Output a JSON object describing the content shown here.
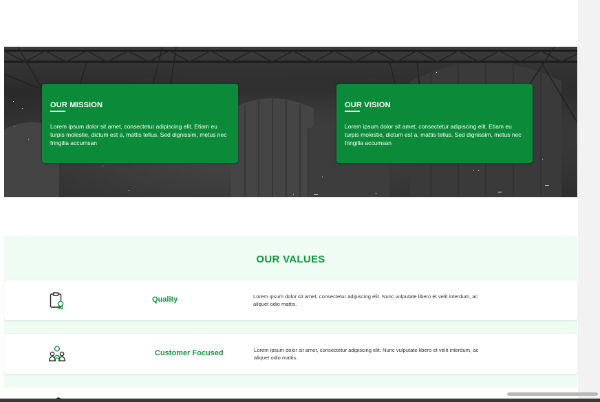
{
  "mission": {
    "title": "OUR MISSION",
    "text": "Lorem ipsum dolor sit amet, consectetur adipiscing elit. Etiam eu turpis molestie, dictum est a, mattis tellus. Sed dignissim, metus nec fringilla accumsan"
  },
  "vision": {
    "title": "OUR VISION",
    "text": "Lorem ipsum dolor sit amet, consectetur adipiscing elit. Etiam eu turpis molestie, dictum est a, mattis tellus. Sed dignissim, metus nec fringilla accumsan"
  },
  "values": {
    "title": "OUR VALUES",
    "items": [
      {
        "icon": "quality-certificate-icon",
        "label": "Quality",
        "text": "Lorem ipsum dolor sit amet, consectetur adipiscing elit. Nunc vulputate libero et velit interdum, ac aliquet odio mattis."
      },
      {
        "icon": "team-people-icon",
        "label": "Customer Focused",
        "text": "Lorem ipsum dolor sit amet, consectetur adipiscing elit. Nunc vulputate libero et velit interdum, ac aliquet odio mattis."
      }
    ]
  },
  "colors": {
    "brand_green": "#0b8b3a",
    "heading_green": "#10963e",
    "values_background": "#effcf3"
  }
}
